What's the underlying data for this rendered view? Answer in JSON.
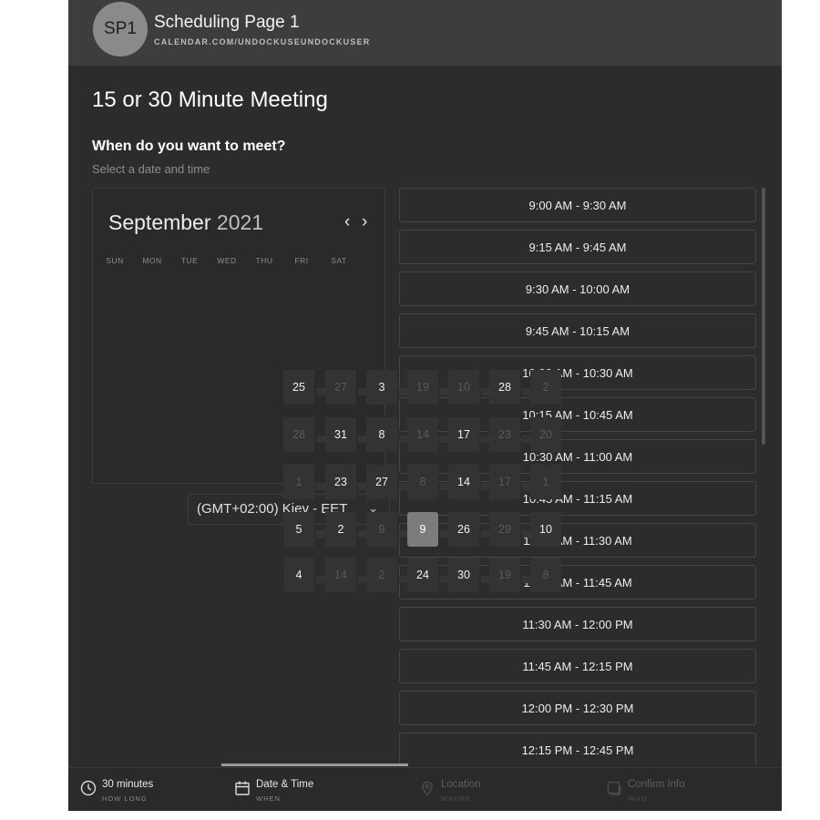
{
  "header": {
    "avatar": "SP1",
    "title": "Scheduling Page 1",
    "url": "CALENDAR.COM/UNDOCKUSEUNDOCKUSER"
  },
  "meeting": {
    "title": "15 or 30 Minute Meeting",
    "question": "When do you want to meet?",
    "hint": "Select a date and time"
  },
  "calendar": {
    "month": "September",
    "year": "2021",
    "prev_icon": "‹",
    "next_icon": "›",
    "weekdays": [
      "SUN",
      "MON",
      "TUE",
      "WED",
      "THU",
      "FRI",
      "SAT"
    ],
    "days": [
      {
        "label": "25",
        "dim": false
      },
      {
        "label": "27",
        "dim": true
      },
      {
        "label": "3",
        "dim": false
      },
      {
        "label": "19",
        "dim": true
      },
      {
        "label": "10",
        "dim": true
      },
      {
        "label": "28",
        "dim": false
      },
      {
        "label": "2",
        "dim": true
      },
      {
        "label": "28",
        "dim": true
      },
      {
        "label": "31",
        "dim": false
      },
      {
        "label": "8",
        "dim": false
      },
      {
        "label": "14",
        "dim": true
      },
      {
        "label": "17",
        "dim": false
      },
      {
        "label": "23",
        "dim": true
      },
      {
        "label": "20",
        "dim": true
      },
      {
        "label": "1",
        "dim": true
      },
      {
        "label": "23",
        "dim": false
      },
      {
        "label": "27",
        "dim": false
      },
      {
        "label": "8",
        "dim": true
      },
      {
        "label": "14",
        "dim": false
      },
      {
        "label": "17",
        "dim": true
      },
      {
        "label": "1",
        "dim": true
      },
      {
        "label": "5",
        "dim": false
      },
      {
        "label": "2",
        "dim": false
      },
      {
        "label": "9",
        "dim": true
      },
      {
        "label": "9",
        "dim": false,
        "selected": true
      },
      {
        "label": "26",
        "dim": false
      },
      {
        "label": "29",
        "dim": true
      },
      {
        "label": "10",
        "dim": false
      },
      {
        "label": "4",
        "dim": false
      },
      {
        "label": "14",
        "dim": true
      },
      {
        "label": "2",
        "dim": true
      },
      {
        "label": "24",
        "dim": false
      },
      {
        "label": "30",
        "dim": false
      },
      {
        "label": "19",
        "dim": true
      },
      {
        "label": "8",
        "dim": true
      }
    ]
  },
  "timezone": {
    "value": "(GMT+02:00) Kiev - EET",
    "chevron_icon": "chevron-down-icon"
  },
  "time_slots": [
    "9:00 AM - 9:30 AM",
    "9:15 AM - 9:45 AM",
    "9:30 AM - 10:00 AM",
    "9:45 AM - 10:15 AM",
    "10:00 AM - 10:30 AM",
    "10:15 AM - 10:45 AM",
    "10:30 AM - 11:00 AM",
    "10:45 AM - 11:15 AM",
    "11:00 AM - 11:30 AM",
    "11:15 AM - 11:45 AM",
    "11:30 AM - 12:00 PM",
    "11:45 AM - 12:15 PM",
    "12:00 PM - 12:30 PM",
    "12:15 PM - 12:45 PM"
  ],
  "footer": {
    "steps": [
      {
        "label": "30 minutes",
        "sub": "HOW LONG",
        "icon": "clock-icon",
        "state": "done"
      },
      {
        "label": "Date & Time",
        "sub": "WHEN",
        "icon": "calendar-icon",
        "state": "active"
      },
      {
        "label": "Location",
        "sub": "WHERE",
        "icon": "location-pin-icon",
        "state": "disabled"
      },
      {
        "label": "Confirm Info",
        "sub": "WHO",
        "icon": "confirm-icon",
        "state": "disabled"
      }
    ]
  },
  "colors": {
    "app_bg": "#2c2c2c",
    "header_bg": "#3d3d3d",
    "selected_day": "#7c7c7c",
    "accent_bar": "#9a9a9a"
  }
}
